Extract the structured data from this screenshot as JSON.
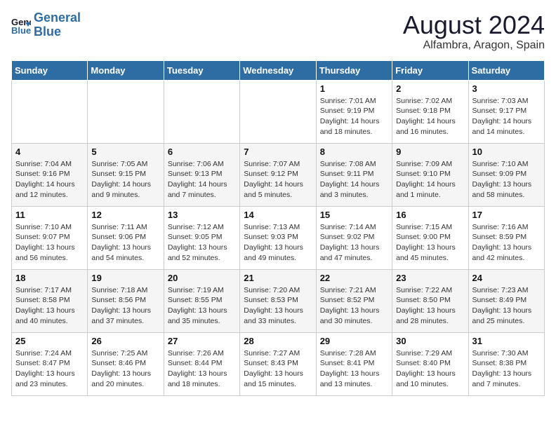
{
  "logo": {
    "line1": "General",
    "line2": "Blue"
  },
  "title": "August 2024",
  "subtitle": "Alfambra, Aragon, Spain",
  "weekdays": [
    "Sunday",
    "Monday",
    "Tuesday",
    "Wednesday",
    "Thursday",
    "Friday",
    "Saturday"
  ],
  "weeks": [
    [
      {
        "day": "",
        "info": ""
      },
      {
        "day": "",
        "info": ""
      },
      {
        "day": "",
        "info": ""
      },
      {
        "day": "",
        "info": ""
      },
      {
        "day": "1",
        "info": "Sunrise: 7:01 AM\nSunset: 9:19 PM\nDaylight: 14 hours\nand 18 minutes."
      },
      {
        "day": "2",
        "info": "Sunrise: 7:02 AM\nSunset: 9:18 PM\nDaylight: 14 hours\nand 16 minutes."
      },
      {
        "day": "3",
        "info": "Sunrise: 7:03 AM\nSunset: 9:17 PM\nDaylight: 14 hours\nand 14 minutes."
      }
    ],
    [
      {
        "day": "4",
        "info": "Sunrise: 7:04 AM\nSunset: 9:16 PM\nDaylight: 14 hours\nand 12 minutes."
      },
      {
        "day": "5",
        "info": "Sunrise: 7:05 AM\nSunset: 9:15 PM\nDaylight: 14 hours\nand 9 minutes."
      },
      {
        "day": "6",
        "info": "Sunrise: 7:06 AM\nSunset: 9:13 PM\nDaylight: 14 hours\nand 7 minutes."
      },
      {
        "day": "7",
        "info": "Sunrise: 7:07 AM\nSunset: 9:12 PM\nDaylight: 14 hours\nand 5 minutes."
      },
      {
        "day": "8",
        "info": "Sunrise: 7:08 AM\nSunset: 9:11 PM\nDaylight: 14 hours\nand 3 minutes."
      },
      {
        "day": "9",
        "info": "Sunrise: 7:09 AM\nSunset: 9:10 PM\nDaylight: 14 hours\nand 1 minute."
      },
      {
        "day": "10",
        "info": "Sunrise: 7:10 AM\nSunset: 9:09 PM\nDaylight: 13 hours\nand 58 minutes."
      }
    ],
    [
      {
        "day": "11",
        "info": "Sunrise: 7:10 AM\nSunset: 9:07 PM\nDaylight: 13 hours\nand 56 minutes."
      },
      {
        "day": "12",
        "info": "Sunrise: 7:11 AM\nSunset: 9:06 PM\nDaylight: 13 hours\nand 54 minutes."
      },
      {
        "day": "13",
        "info": "Sunrise: 7:12 AM\nSunset: 9:05 PM\nDaylight: 13 hours\nand 52 minutes."
      },
      {
        "day": "14",
        "info": "Sunrise: 7:13 AM\nSunset: 9:03 PM\nDaylight: 13 hours\nand 49 minutes."
      },
      {
        "day": "15",
        "info": "Sunrise: 7:14 AM\nSunset: 9:02 PM\nDaylight: 13 hours\nand 47 minutes."
      },
      {
        "day": "16",
        "info": "Sunrise: 7:15 AM\nSunset: 9:00 PM\nDaylight: 13 hours\nand 45 minutes."
      },
      {
        "day": "17",
        "info": "Sunrise: 7:16 AM\nSunset: 8:59 PM\nDaylight: 13 hours\nand 42 minutes."
      }
    ],
    [
      {
        "day": "18",
        "info": "Sunrise: 7:17 AM\nSunset: 8:58 PM\nDaylight: 13 hours\nand 40 minutes."
      },
      {
        "day": "19",
        "info": "Sunrise: 7:18 AM\nSunset: 8:56 PM\nDaylight: 13 hours\nand 37 minutes."
      },
      {
        "day": "20",
        "info": "Sunrise: 7:19 AM\nSunset: 8:55 PM\nDaylight: 13 hours\nand 35 minutes."
      },
      {
        "day": "21",
        "info": "Sunrise: 7:20 AM\nSunset: 8:53 PM\nDaylight: 13 hours\nand 33 minutes."
      },
      {
        "day": "22",
        "info": "Sunrise: 7:21 AM\nSunset: 8:52 PM\nDaylight: 13 hours\nand 30 minutes."
      },
      {
        "day": "23",
        "info": "Sunrise: 7:22 AM\nSunset: 8:50 PM\nDaylight: 13 hours\nand 28 minutes."
      },
      {
        "day": "24",
        "info": "Sunrise: 7:23 AM\nSunset: 8:49 PM\nDaylight: 13 hours\nand 25 minutes."
      }
    ],
    [
      {
        "day": "25",
        "info": "Sunrise: 7:24 AM\nSunset: 8:47 PM\nDaylight: 13 hours\nand 23 minutes."
      },
      {
        "day": "26",
        "info": "Sunrise: 7:25 AM\nSunset: 8:46 PM\nDaylight: 13 hours\nand 20 minutes."
      },
      {
        "day": "27",
        "info": "Sunrise: 7:26 AM\nSunset: 8:44 PM\nDaylight: 13 hours\nand 18 minutes."
      },
      {
        "day": "28",
        "info": "Sunrise: 7:27 AM\nSunset: 8:43 PM\nDaylight: 13 hours\nand 15 minutes."
      },
      {
        "day": "29",
        "info": "Sunrise: 7:28 AM\nSunset: 8:41 PM\nDaylight: 13 hours\nand 13 minutes."
      },
      {
        "day": "30",
        "info": "Sunrise: 7:29 AM\nSunset: 8:40 PM\nDaylight: 13 hours\nand 10 minutes."
      },
      {
        "day": "31",
        "info": "Sunrise: 7:30 AM\nSunset: 8:38 PM\nDaylight: 13 hours\nand 7 minutes."
      }
    ]
  ]
}
